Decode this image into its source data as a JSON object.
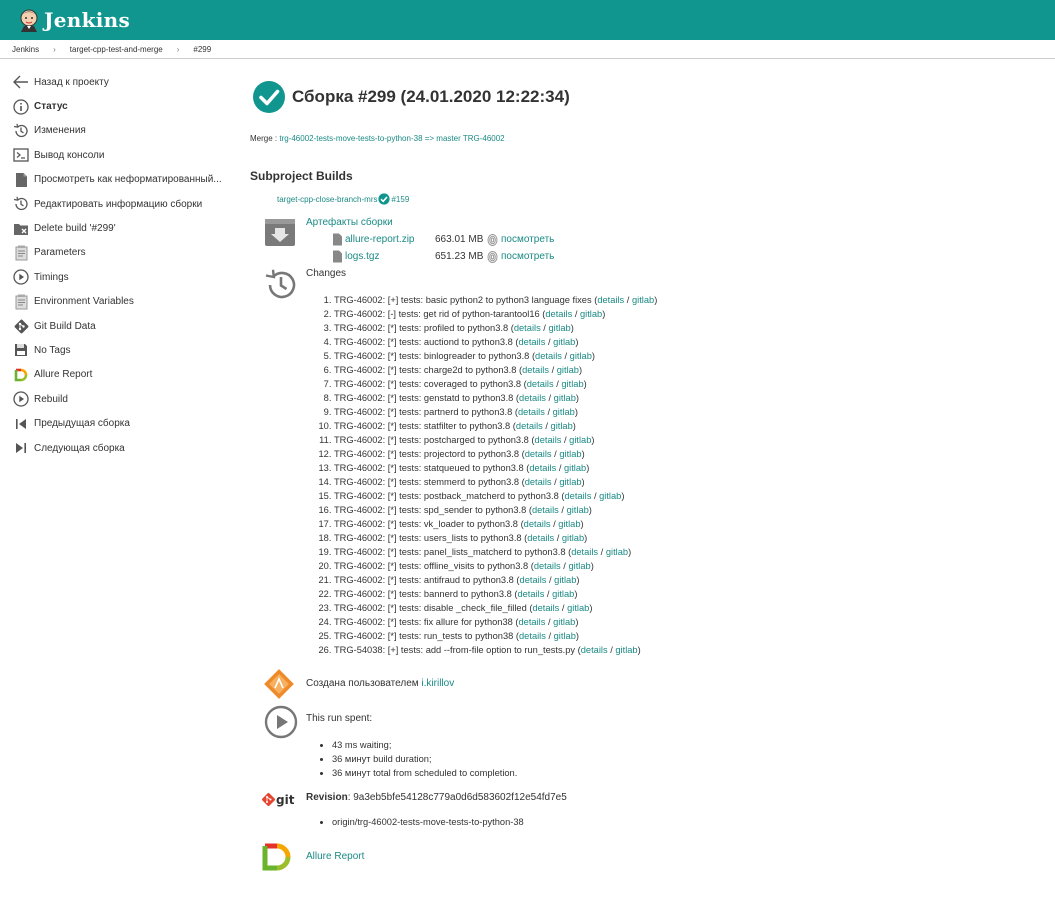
{
  "header": {
    "title": "Jenkins"
  },
  "breadcrumbs": [
    "Jenkins",
    "target-cpp-test-and-merge",
    "#299"
  ],
  "sidebar": {
    "items": [
      {
        "label": "Назад к проекту",
        "icon": "arrow-left-icon"
      },
      {
        "label": "Статус",
        "icon": "info-icon",
        "active": true
      },
      {
        "label": "Изменения",
        "icon": "history-icon"
      },
      {
        "label": "Вывод консоли",
        "icon": "terminal-icon"
      },
      {
        "label": "Просмотреть как неформатированный...",
        "icon": "document-icon"
      },
      {
        "label": "Редактировать информацию сборки",
        "icon": "history-icon"
      },
      {
        "label": "Delete build '#299'",
        "icon": "folder-delete-icon"
      },
      {
        "label": "Parameters",
        "icon": "notepad-icon"
      },
      {
        "label": "Timings",
        "icon": "play-icon"
      },
      {
        "label": "Environment Variables",
        "icon": "notepad-icon"
      },
      {
        "label": "Git Build Data",
        "icon": "git-icon"
      },
      {
        "label": "No Tags",
        "icon": "save-icon"
      },
      {
        "label": "Allure Report",
        "icon": "allure-icon"
      },
      {
        "label": "Rebuild",
        "icon": "play-icon"
      },
      {
        "label": "Предыдущая сборка",
        "icon": "previous-icon"
      },
      {
        "label": "Следующая сборка",
        "icon": "next-icon"
      }
    ]
  },
  "main": {
    "title": "Сборка #299 (24.01.2020 12:22:34)",
    "merge_label": "Merge : ",
    "merge_link": "trg-46002-tests-move-tests-to-python-38 => master TRG-46002",
    "subproject_heading": "Subproject Builds",
    "subproject_job": "target-cpp-close-branch-mrs",
    "subproject_build": "#159",
    "artifacts": {
      "title": "Артефакты сборки",
      "files": [
        {
          "name": "allure-report.zip",
          "size": "663.01 MB",
          "view": "посмотреть"
        },
        {
          "name": "logs.tgz",
          "size": "651.23 MB",
          "view": "посмотреть"
        }
      ]
    },
    "changes": {
      "title": "Changes",
      "details_label": "details",
      "gitlab_label": "gitlab",
      "items": [
        "TRG-46002: [+] tests: basic python2 to python3 language fixes",
        "TRG-46002: [-] tests: get rid of python-tarantool16",
        "TRG-46002: [*] tests: profiled to python3.8",
        "TRG-46002: [*] tests: auctiond to python3.8",
        "TRG-46002: [*] tests: binlogreader to python3.8",
        "TRG-46002: [*] tests: charge2d to python3.8",
        "TRG-46002: [*] tests: coveraged to python3.8",
        "TRG-46002: [*] tests: genstatd to python3.8",
        "TRG-46002: [*] tests: partnerd to python3.8",
        "TRG-46002: [*] tests: statfilter to python3.8",
        "TRG-46002: [*] tests: postcharged to python3.8",
        "TRG-46002: [*] tests: projectord to python3.8",
        "TRG-46002: [*] tests: statqueued to python3.8",
        "TRG-46002: [*] tests: stemmerd to python3.8",
        "TRG-46002: [*] tests: postback_matcherd to python3.8",
        "TRG-46002: [*] tests: spd_sender to python3.8",
        "TRG-46002: [*] tests: vk_loader to python3.8",
        "TRG-46002: [*] tests: users_lists to python3.8",
        "TRG-46002: [*] tests: panel_lists_matcherd to python3.8",
        "TRG-46002: [*] tests: offline_visits to python3.8",
        "TRG-46002: [*] tests: antifraud to python3.8",
        "TRG-46002: [*] tests: bannerd to python3.8",
        "TRG-46002: [*] tests: disable _check_file_filled",
        "TRG-46002: [*] tests: fix allure for python38",
        "TRG-46002: [*] tests: run_tests to python38",
        "TRG-54038: [+] tests: add --from-file option to run_tests.py"
      ]
    },
    "created_by": {
      "label": "Создана пользователем ",
      "user": "i.kirillov"
    },
    "run_spent": {
      "title": "This run spent:",
      "items": [
        "43 ms waiting;",
        "36 минут build duration;",
        "36 минут total from scheduled to completion."
      ]
    },
    "revision": {
      "label": "Revision",
      "hash": ": 9a3eb5bfe54128c779a0d6d583602f12e54fd7e5",
      "branches": [
        "origin/trg-46002-tests-move-tests-to-python-38"
      ]
    },
    "allure_link": "Allure Report"
  },
  "colors": {
    "header": "#10968f",
    "link": "#1a8a84",
    "success": "#10968f"
  }
}
